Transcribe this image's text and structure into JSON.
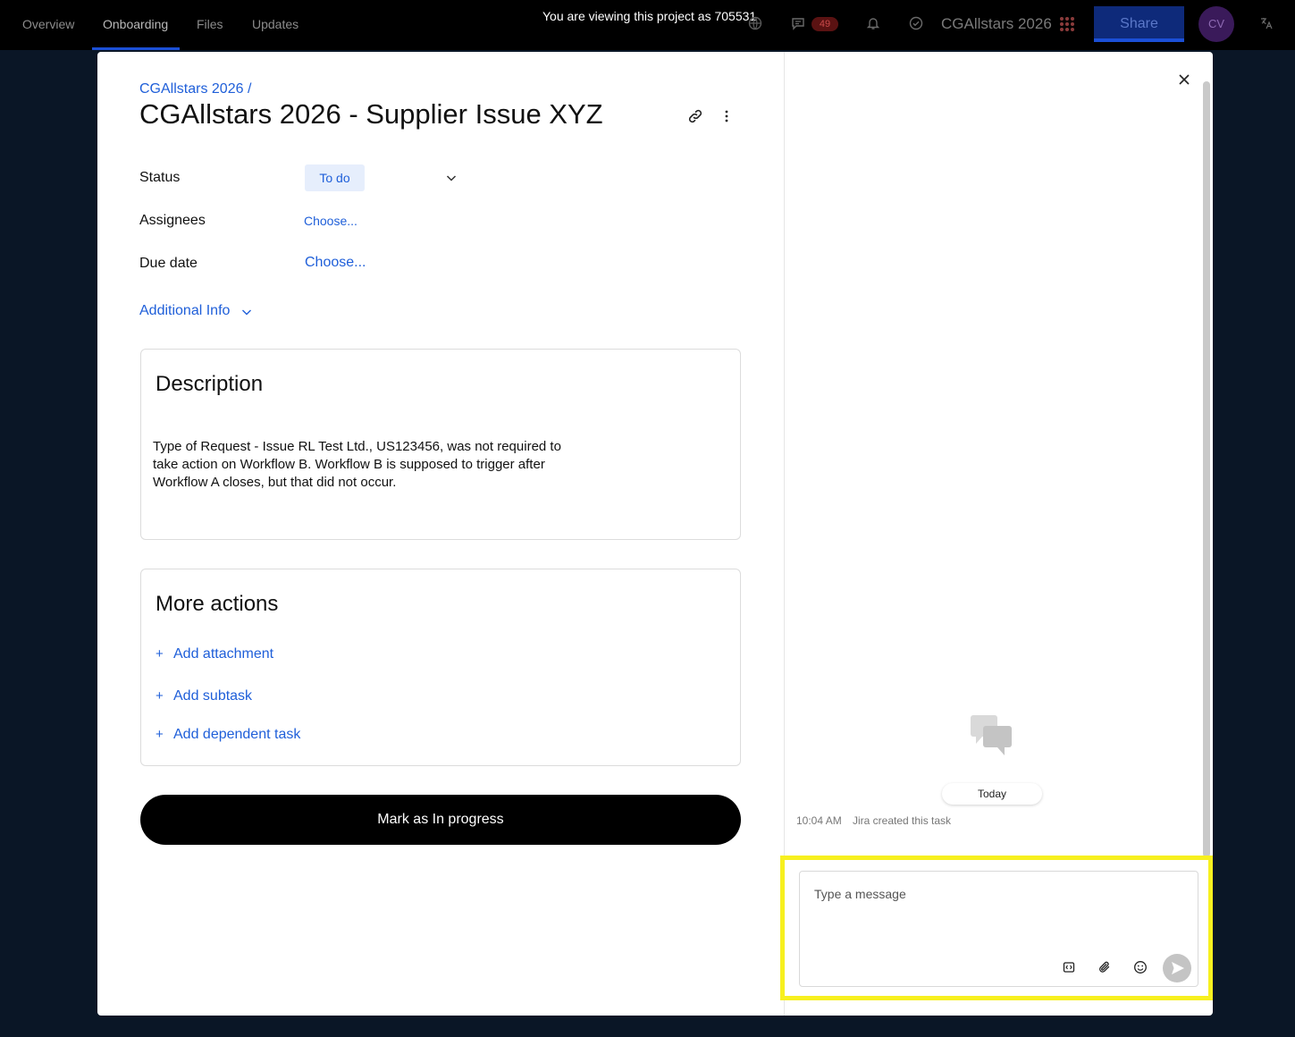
{
  "topbar": {
    "tabs": [
      {
        "label": "Overview"
      },
      {
        "label": "Onboarding"
      },
      {
        "label": "Files"
      },
      {
        "label": "Updates"
      }
    ],
    "viewing_banner": "You are viewing this project as 705531",
    "comments_count": "49",
    "project_name": "CGAllstars 2026",
    "share_label": "Share",
    "avatar_initials": "CV",
    "icons": [
      "globe-icon",
      "comment-icon",
      "bell-icon",
      "check-circle-icon",
      "apps-grid-icon",
      "translate-icon"
    ]
  },
  "task": {
    "breadcrumb": "CGAllstars 2026 /",
    "title": "CGAllstars 2026 - Supplier Issue XYZ",
    "fields": {
      "status_label": "Status",
      "status_value": "To do",
      "assignees_label": "Assignees",
      "assignees_value": "Choose...",
      "due_label": "Due date",
      "due_value": "Choose..."
    },
    "additional_info": "Additional Info",
    "description": {
      "title": "Description",
      "lines": [
        "Type of Request - Issue RL Test Ltd., US123456, was not required to",
        "take action on Workflow B. Workflow B is supposed to trigger after",
        "Workflow A closes, but that did not occur."
      ]
    },
    "more_actions": {
      "title": "More actions",
      "items": [
        {
          "label": "Add attachment"
        },
        {
          "label": "Add subtask"
        },
        {
          "label": "Add dependent task"
        }
      ]
    },
    "primary_action": "Mark as In progress"
  },
  "activity": {
    "date_pill": "Today",
    "entries": [
      {
        "time": "10:04 AM",
        "text": "Jira created this task"
      }
    ],
    "composer_placeholder": "Type a message"
  },
  "colors": {
    "accent": "#1f5fd9",
    "highlight": "#f7f01f",
    "status_bg": "#e6eefc"
  }
}
